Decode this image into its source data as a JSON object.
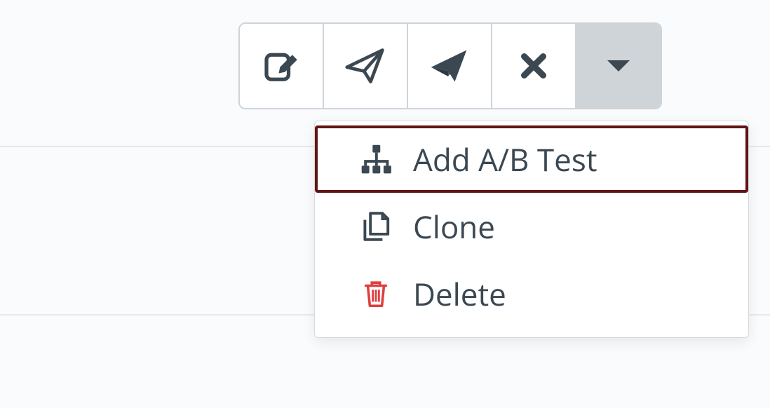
{
  "toolbar": {
    "buttons": [
      {
        "name": "edit-button",
        "icon": "edit-icon"
      },
      {
        "name": "send-test-button",
        "icon": "paper-plane-outline-icon"
      },
      {
        "name": "send-button",
        "icon": "paper-plane-solid-icon"
      },
      {
        "name": "cancel-button",
        "icon": "close-icon"
      },
      {
        "name": "more-actions-button",
        "icon": "caret-down-icon"
      }
    ]
  },
  "dropdown": {
    "items": [
      {
        "name": "menu-item-add-ab-test",
        "icon": "sitemap-icon",
        "label": "Add A/B Test",
        "highlighted": true
      },
      {
        "name": "menu-item-clone",
        "icon": "clone-icon",
        "label": "Clone"
      },
      {
        "name": "menu-item-delete",
        "icon": "trash-icon",
        "label": "Delete",
        "danger": true
      }
    ]
  },
  "colors": {
    "icon": "#3b4852",
    "danger": "#e03e3e",
    "highlightBorder": "#621414",
    "caretBg": "#cfd4d9"
  }
}
